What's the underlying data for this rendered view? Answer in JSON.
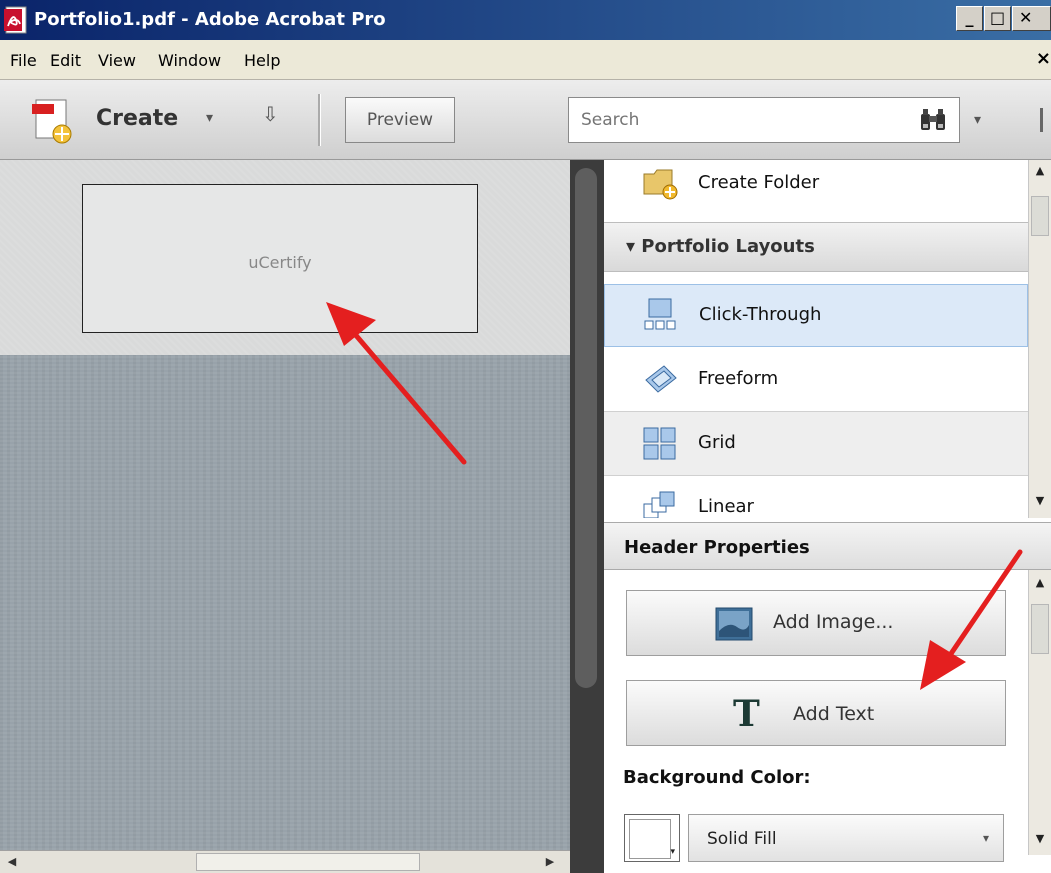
{
  "window": {
    "title": "Portfolio1.pdf - Adobe Acrobat Pro"
  },
  "menu": {
    "items": [
      "File",
      "Edit",
      "View",
      "Window",
      "Help"
    ],
    "close_glyph": "×"
  },
  "toolbar": {
    "create_label": "Create",
    "dropdown_glyph": "▾",
    "more_glyph": "⇩",
    "preview_label": "Preview",
    "search_placeholder": "Search"
  },
  "header_preview": {
    "text": "uCertify"
  },
  "layouts_panel": {
    "create_folder": "Create Folder",
    "section_title": "▾ Portfolio Layouts",
    "items": [
      {
        "label": "Click-Through",
        "selected": true
      },
      {
        "label": "Freeform",
        "selected": false
      },
      {
        "label": "Grid",
        "selected": false
      },
      {
        "label": "Linear",
        "selected": false
      }
    ]
  },
  "header_properties": {
    "title": "Header Properties",
    "add_image": "Add Image...",
    "add_text": "Add Text",
    "text_glyph": "T",
    "background_color_label": "Background Color:",
    "fill_type": "Solid Fill"
  },
  "colors": {
    "selected_row": "#dce9f8",
    "annotation_arrow": "#e41f1f"
  }
}
